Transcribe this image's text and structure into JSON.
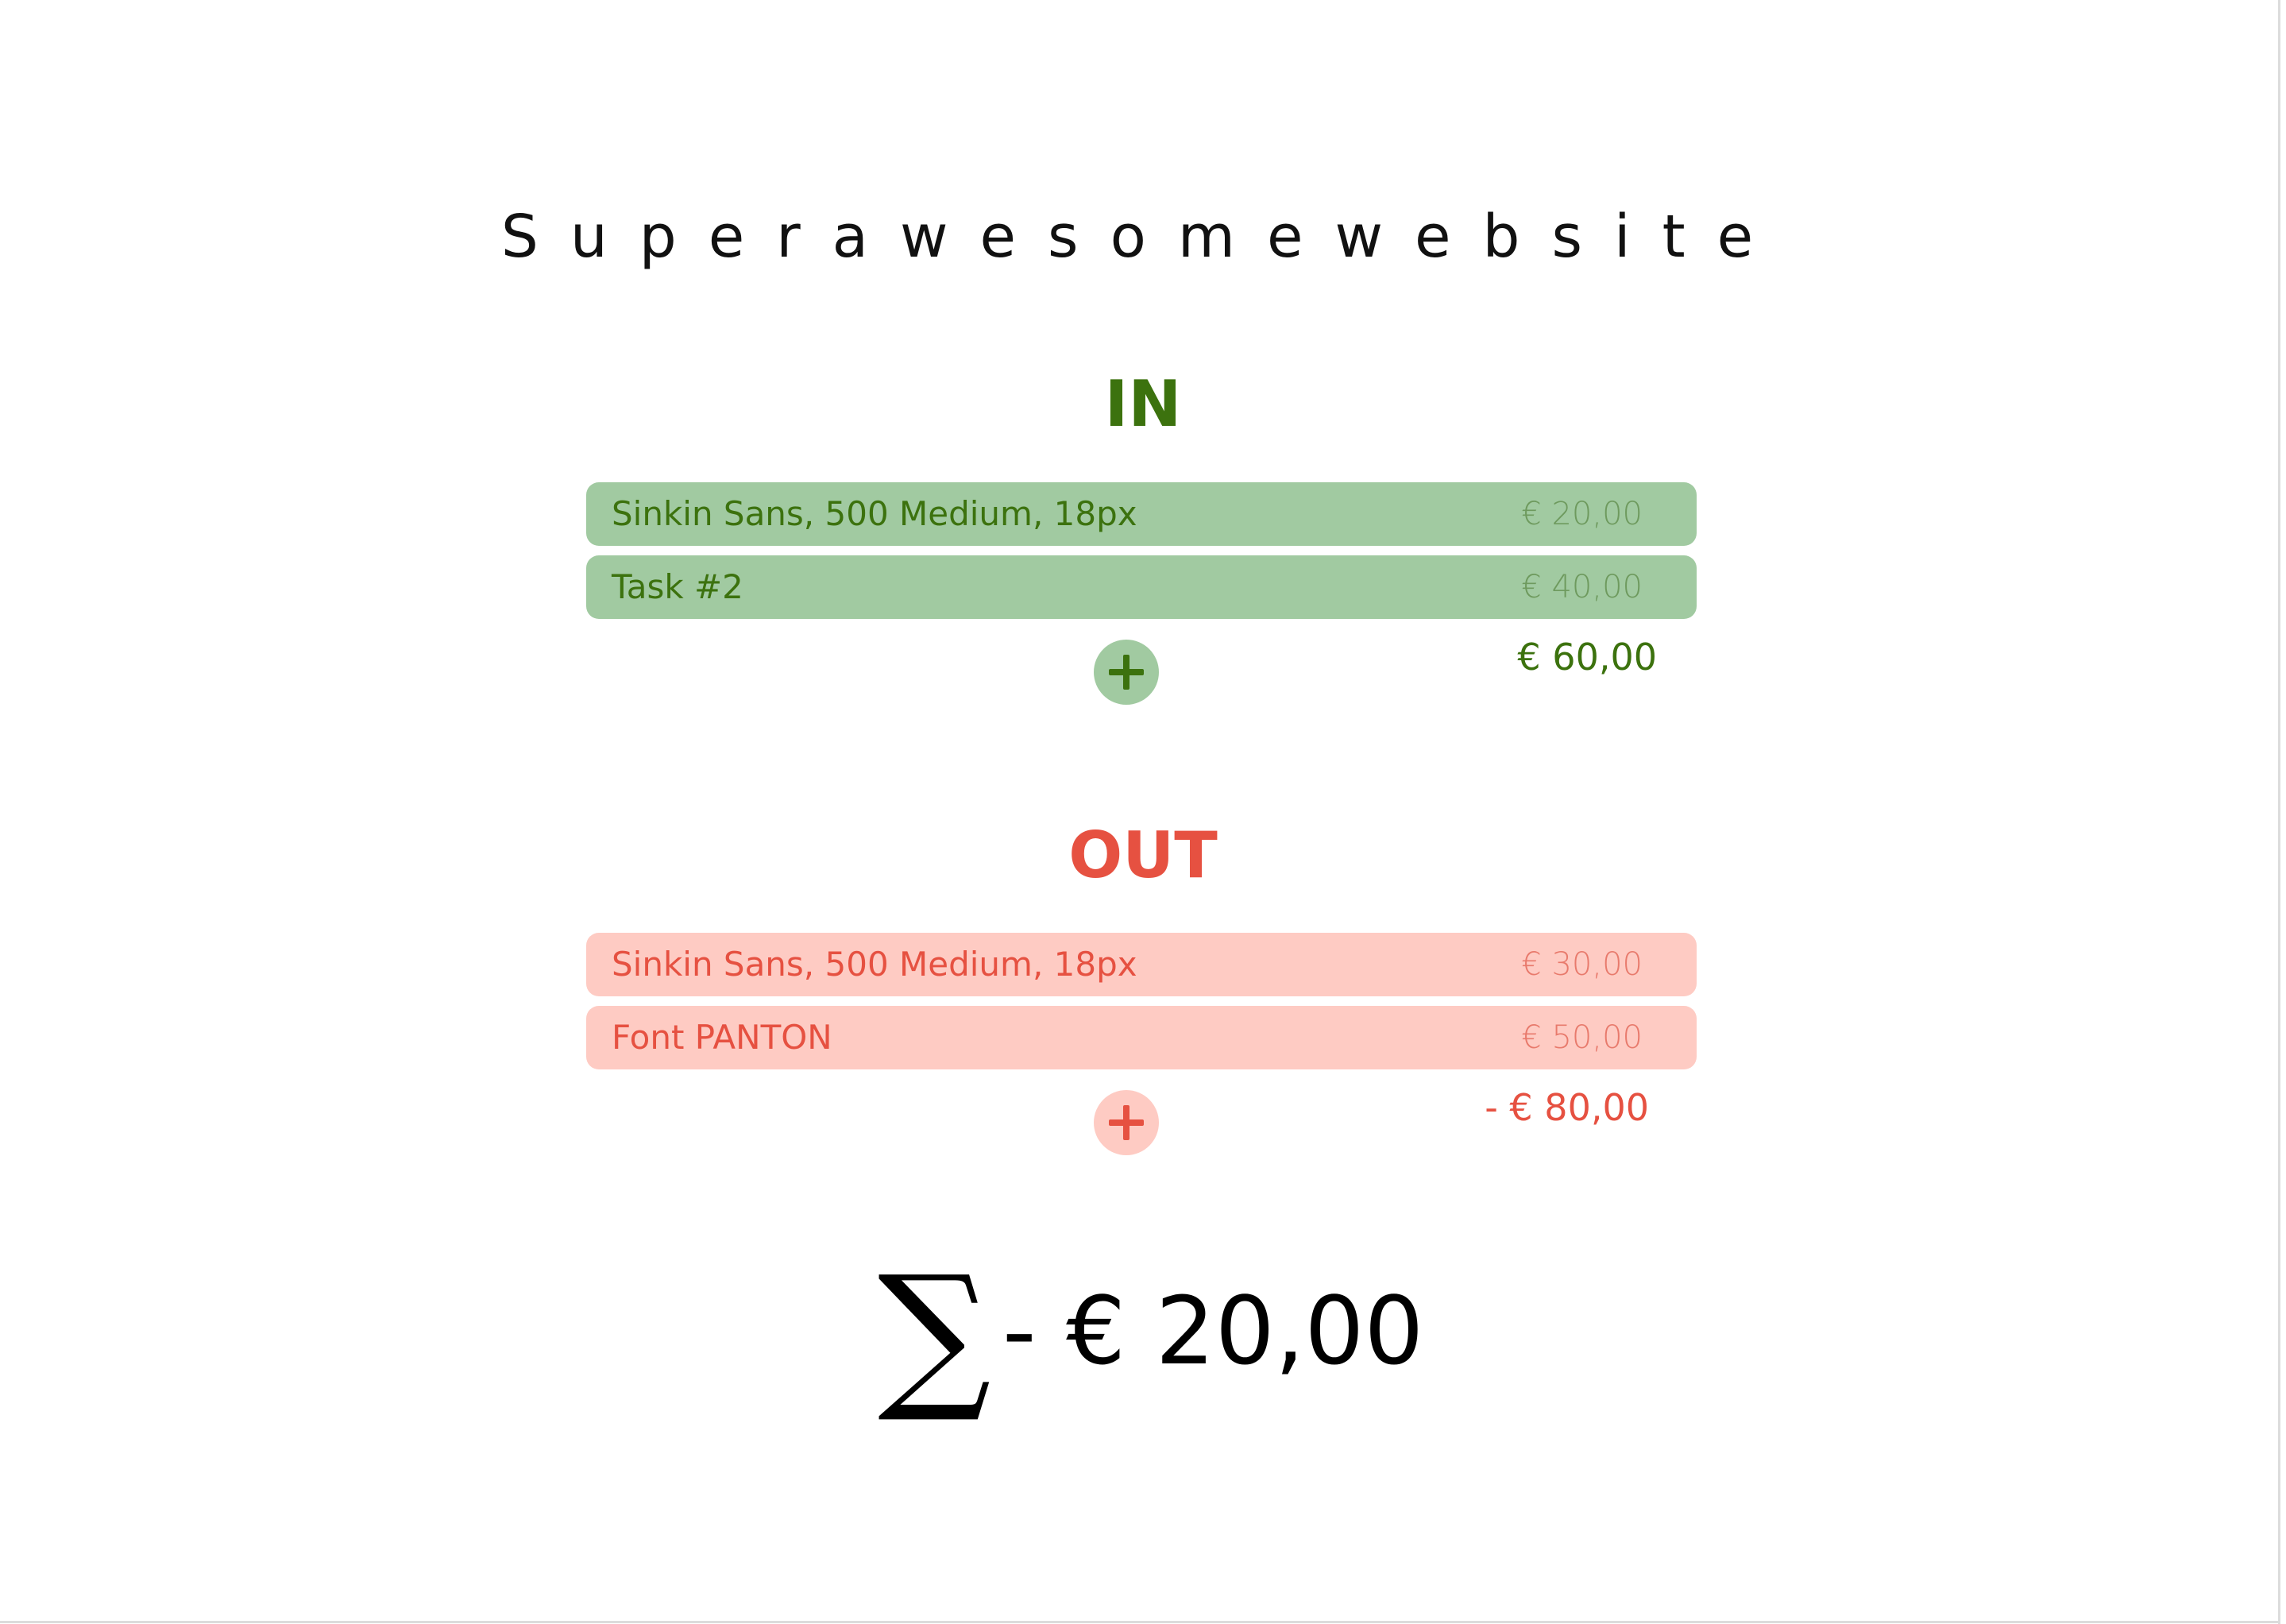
{
  "site": {
    "title": "Superawesomewebsite"
  },
  "colors": {
    "in_text": "#3c720e",
    "in_row_bg": "#a1caa1",
    "in_amount": "#6e9a5e",
    "out_text": "#e65141",
    "out_row_bg": "#fecbc3",
    "out_amount": "#e87a6c",
    "total_text": "#000000"
  },
  "income": {
    "heading": "IN",
    "items": [
      {
        "label": "Sinkin Sans, 500 Medium, 18px",
        "amount": "€ 20,00"
      },
      {
        "label": "Task #2",
        "amount": "€ 40,00"
      }
    ],
    "add_icon": "plus-icon",
    "subtotal": "€ 60,00"
  },
  "expenses": {
    "heading": "OUT",
    "items": [
      {
        "label": "Sinkin Sans, 500 Medium, 18px",
        "amount": "€ 30,00"
      },
      {
        "label": "Font PANTON",
        "amount": "€ 50,00"
      }
    ],
    "add_icon": "plus-icon",
    "subtotal": "- € 80,00"
  },
  "total": {
    "symbol": "∑",
    "value": "- € 20,00"
  }
}
